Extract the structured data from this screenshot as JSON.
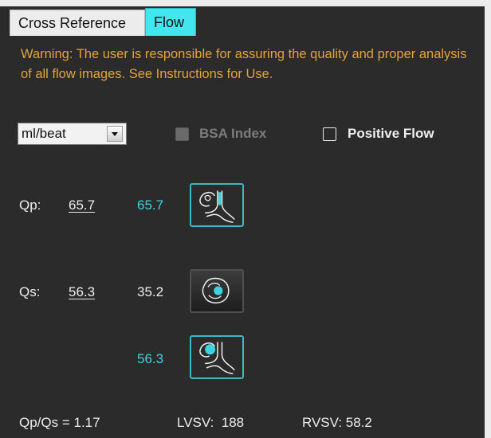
{
  "tabs": {
    "cross_reference": "Cross Reference",
    "flow": "Flow"
  },
  "warning": "Warning: The user is responsible for assuring the quality and proper analysis of all flow images. See Instructions for Use.",
  "units_select": {
    "value": "ml/beat"
  },
  "checkboxes": {
    "bsa_index": {
      "label": "BSA Index",
      "checked": false,
      "enabled": false
    },
    "positive_flow": {
      "label": "Positive Flow",
      "checked": false,
      "enabled": true
    }
  },
  "qp": {
    "label": "Qp:",
    "value": "65.7",
    "component": "65.7"
  },
  "qs": {
    "label": "Qs:",
    "value": "56.3",
    "component_1": "35.2",
    "component_2": "56.3"
  },
  "summary": {
    "ratio": "Qp/Qs = 1.17",
    "lvsv": "LVSV:  188",
    "rvsv": "RVSV: 58.2"
  },
  "icons": {
    "qp_vessel": "pulmonary-flow-vessel-icon",
    "qs_heart": "heart-flow-icon",
    "qs_vessel": "aortic-flow-vessel-icon"
  },
  "colors": {
    "accent": "#43e6ee",
    "warning": "#e2a43a",
    "value_cyan": "#3dd4de",
    "background": "#2b2b2b"
  }
}
